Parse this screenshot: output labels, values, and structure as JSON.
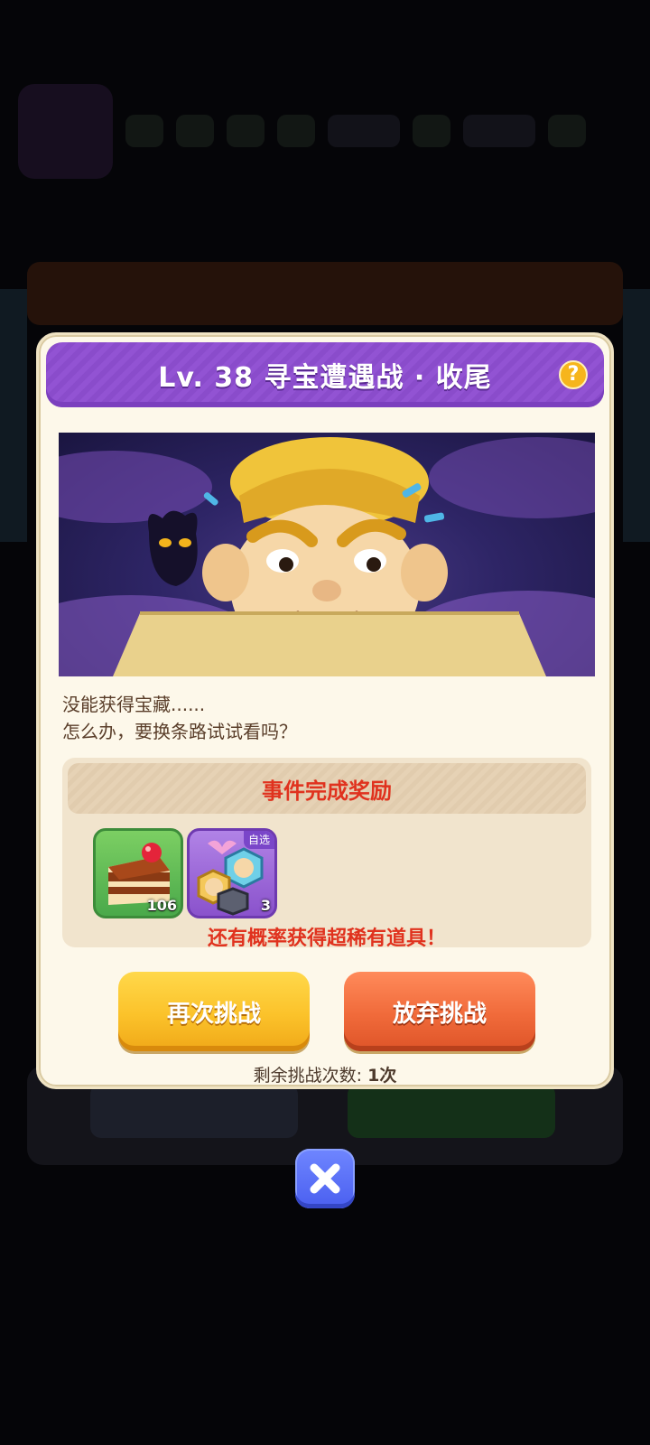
{
  "dialog": {
    "title": "Lv. 38 寻宝遭遇战 · 收尾",
    "help_icon": "question-mark-icon",
    "story_line1": "没能获得宝藏......",
    "story_line2": "怎么办，要换条路试试看吗？",
    "reward": {
      "title": "事件完成奖励",
      "items": [
        {
          "icon": "cake-icon",
          "count": "106"
        },
        {
          "icon": "hero-selection-chest-icon",
          "count": "3",
          "badge": "自选"
        }
      ],
      "note": "还有概率获得超稀有道具！"
    },
    "retry_label": "再次挑战",
    "giveup_label": "放弃挑战",
    "remaining_label": "剩余挑战次数:",
    "remaining_value": "1次"
  },
  "close_icon": "close-x-icon",
  "colors": {
    "title_bar": "#9253d3",
    "reward_text": "#e0321e",
    "retry_button": "#fbc22a",
    "giveup_button": "#f06a3a",
    "close_button": "#5a70f8"
  }
}
